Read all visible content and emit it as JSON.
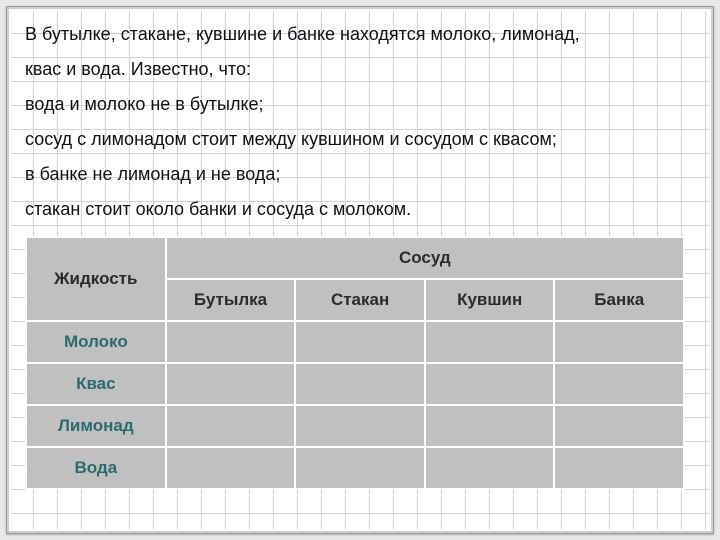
{
  "problem": {
    "lines": [
      "В бутылке, стакане, кувшине и банке находятся молоко, лимонад,",
      "квас и вода.  Известно, что:",
      "вода и молоко не в бутылке;",
      "сосуд с лимонадом стоит между кувшином и сосудом с квасом;",
      "в банке не лимонад и не вода;",
      "стакан стоит около банки и сосуда с молоком."
    ]
  },
  "table": {
    "liquid_header": "Жидкость",
    "vessel_header": "Сосуд",
    "vessels": [
      "Бутылка",
      "Стакан",
      "Кувшин",
      "Банка"
    ],
    "liquids": [
      "Молоко",
      "Квас",
      "Лимонад",
      "Вода"
    ],
    "cells": [
      [
        "",
        "",
        "",
        ""
      ],
      [
        "",
        "",
        "",
        ""
      ],
      [
        "",
        "",
        "",
        ""
      ],
      [
        "",
        "",
        "",
        ""
      ]
    ]
  },
  "chart_data": {
    "type": "table",
    "row_label": "Жидкость",
    "col_label": "Сосуд",
    "rows": [
      "Молоко",
      "Квас",
      "Лимонад",
      "Вода"
    ],
    "columns": [
      "Бутылка",
      "Стакан",
      "Кувшин",
      "Банка"
    ],
    "values": [
      [
        "",
        "",
        "",
        ""
      ],
      [
        "",
        "",
        "",
        ""
      ],
      [
        "",
        "",
        "",
        ""
      ],
      [
        "",
        "",
        "",
        ""
      ]
    ]
  }
}
